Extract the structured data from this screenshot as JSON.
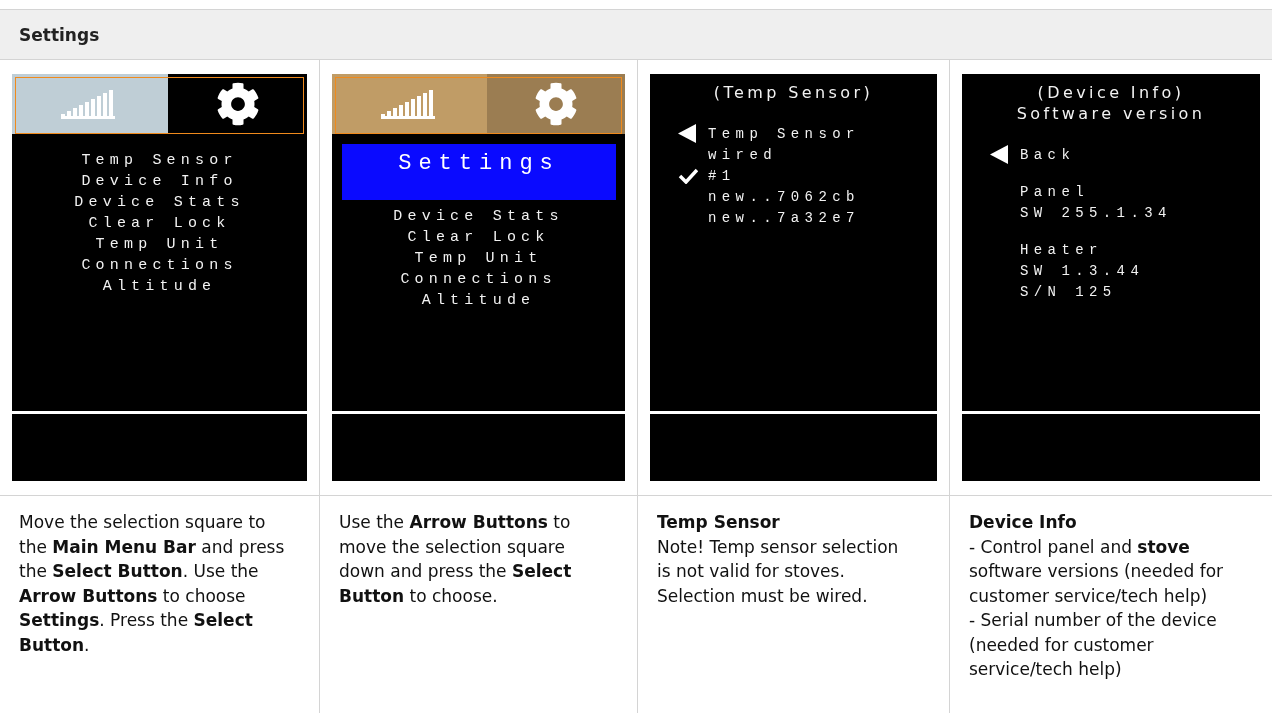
{
  "table": {
    "title": "Settings",
    "columns": [
      {
        "screen": {
          "kind": "menu",
          "menu_bar": {
            "tiles": [
              {
                "kind": "signal",
                "color": "#bfced6"
              },
              {
                "kind": "gear",
                "color": "#000000"
              }
            ]
          },
          "items": [
            "Temp Sensor",
            "Device Info",
            "Device Stats",
            "Clear Lock",
            "Temp Unit",
            "Connections",
            "Altitude"
          ]
        },
        "description": {
          "paragraphs": [
            "Move the selection square to the **Main Menu Bar** and press the **Select Button**. Use the **Arrow Buttons** to choose **Settings**. Press the **Select Button**."
          ]
        }
      },
      {
        "screen": {
          "kind": "menu",
          "menu_bar": {
            "tiles": [
              {
                "kind": "signal",
                "color": "#c09c66"
              },
              {
                "kind": "gear",
                "color": "#9b7d52"
              }
            ]
          },
          "popup": "Settings",
          "items": [
            "Device Stats",
            "Clear Lock",
            "Temp Unit",
            "Connections",
            "Altitude"
          ]
        },
        "description": {
          "paragraphs": [
            "Use the **Arrow Buttons** to move the selection square down and press the **Select Button** to choose."
          ]
        }
      },
      {
        "screen": {
          "kind": "list",
          "titles": [
            "(Temp Sensor)"
          ],
          "sections": [
            [
              {
                "kind": "back",
                "text": "Temp Sensor"
              },
              {
                "kind": "plain",
                "text": "wired"
              },
              {
                "kind": "check",
                "text": "#1"
              },
              {
                "kind": "plain",
                "text": "new..7062cb"
              },
              {
                "kind": "plain",
                "text": "new..7a32e7"
              }
            ]
          ]
        },
        "description": {
          "heading": "Temp Sensor",
          "paragraphs": [
            "Note! Temp sensor selection is not valid for stoves. Selection must be wired."
          ]
        }
      },
      {
        "screen": {
          "kind": "list",
          "titles": [
            "(Device Info)",
            "Software version"
          ],
          "sections": [
            [
              {
                "kind": "back",
                "text": "Back"
              }
            ],
            [
              {
                "kind": "plain",
                "text": "Panel"
              },
              {
                "kind": "plain",
                "text": "SW 255.1.34"
              }
            ],
            [
              {
                "kind": "plain",
                "text": "Heater"
              },
              {
                "kind": "plain",
                "text": "SW 1.3.44"
              },
              {
                "kind": "plain",
                "text": "S/N 125"
              }
            ]
          ]
        },
        "description": {
          "heading": "Device Info",
          "paragraphs": [
            "- Control panel and **stove** software versions (needed for customer service/tech help)",
            "- Serial number of the device (needed for customer service/tech help)"
          ]
        }
      }
    ]
  }
}
